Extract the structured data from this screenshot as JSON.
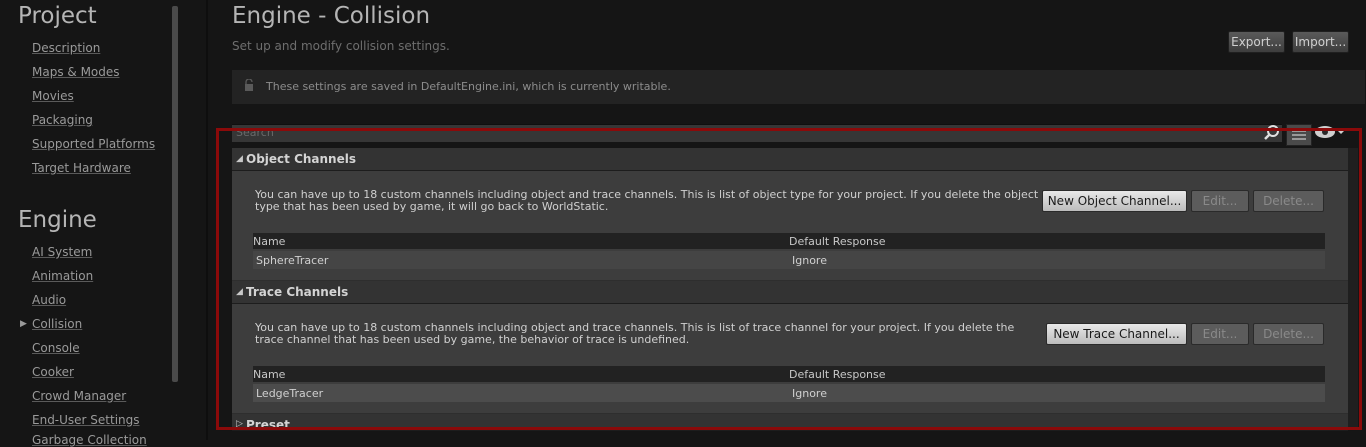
{
  "sidebar": {
    "project_heading": "Project",
    "project_items": [
      "Description",
      "Maps & Modes",
      "Movies",
      "Packaging",
      "Supported Platforms",
      "Target Hardware"
    ],
    "engine_heading": "Engine",
    "engine_items": [
      "AI System",
      "Animation",
      "Audio",
      "Collision",
      "Console",
      "Cooker",
      "Crowd Manager",
      "End-User Settings",
      "Garbage Collection"
    ]
  },
  "header": {
    "title": "Engine - Collision",
    "subtitle": "Set up and modify collision settings.",
    "export_label": "Export...",
    "import_label": "Import..."
  },
  "notice": {
    "text": "These settings are saved in DefaultEngine.ini, which is currently writable."
  },
  "search": {
    "placeholder": "Search"
  },
  "object_channels": {
    "title": "Object Channels",
    "description": "You can have up to 18 custom channels including object and trace channels. This is list of object type for your project. If you delete the object type that has been used by game, it will go back to WorldStatic.",
    "new_label": "New Object Channel...",
    "edit_label": "Edit...",
    "delete_label": "Delete...",
    "col_name": "Name",
    "col_response": "Default Response",
    "rows": [
      {
        "name": "SphereTracer",
        "response": "Ignore"
      }
    ]
  },
  "trace_channels": {
    "title": "Trace Channels",
    "description": "You can have up to 18 custom channels including object and trace channels. This is list of trace channel for your project. If you delete the trace channel that has been used by game, the behavior of trace is undefined.",
    "new_label": "New Trace Channel...",
    "edit_label": "Edit...",
    "delete_label": "Delete...",
    "col_name": "Name",
    "col_response": "Default Response",
    "rows": [
      {
        "name": "LedgeTracer",
        "response": "Ignore"
      }
    ]
  },
  "preset": {
    "title": "Preset"
  },
  "colors": {
    "highlight": "#8b0a0a",
    "background": "#151515"
  }
}
